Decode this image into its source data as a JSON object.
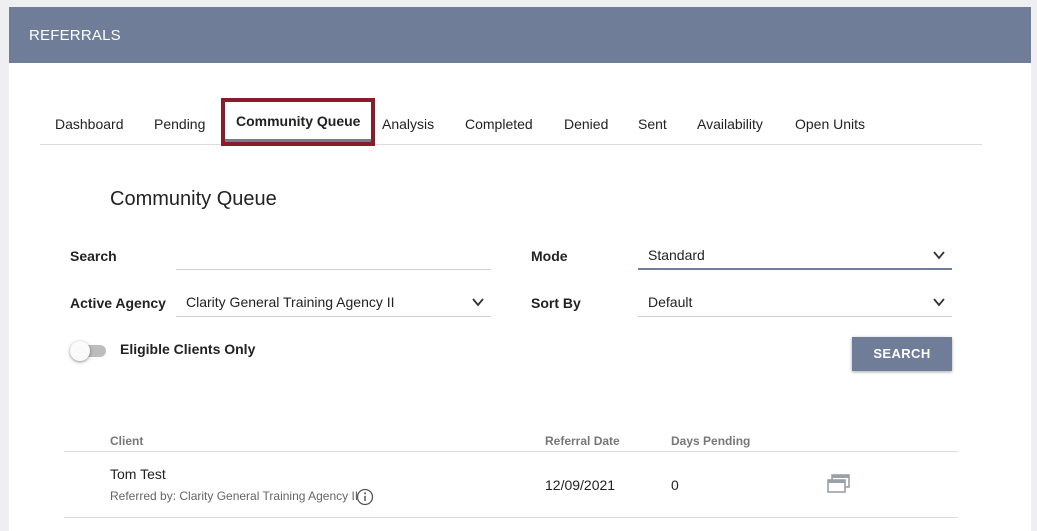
{
  "header": {
    "title": "REFERRALS"
  },
  "tabs": [
    {
      "label": "Dashboard"
    },
    {
      "label": "Pending"
    },
    {
      "label": "Community Queue"
    },
    {
      "label": "Analysis"
    },
    {
      "label": "Completed"
    },
    {
      "label": "Denied"
    },
    {
      "label": "Sent"
    },
    {
      "label": "Availability"
    },
    {
      "label": "Open Units"
    }
  ],
  "section": {
    "title": "Community Queue"
  },
  "filters": {
    "search_label": "Search",
    "search_value": "",
    "mode_label": "Mode",
    "mode_value": "Standard",
    "agency_label": "Active Agency",
    "agency_value": "Clarity General Training Agency II",
    "sort_label": "Sort By",
    "sort_value": "Default",
    "eligible_label": "Eligible Clients Only",
    "search_button": "SEARCH"
  },
  "table": {
    "headers": {
      "client": "Client",
      "referral_date": "Referral Date",
      "days_pending": "Days Pending"
    },
    "rows": [
      {
        "client": "Tom Test",
        "referred_by": "Referred by: Clarity General Training Agency II",
        "referral_date": "12/09/2021",
        "days_pending": "0"
      }
    ]
  },
  "colors": {
    "header": "#6f7d99",
    "highlight_border": "#8b1a2b"
  }
}
